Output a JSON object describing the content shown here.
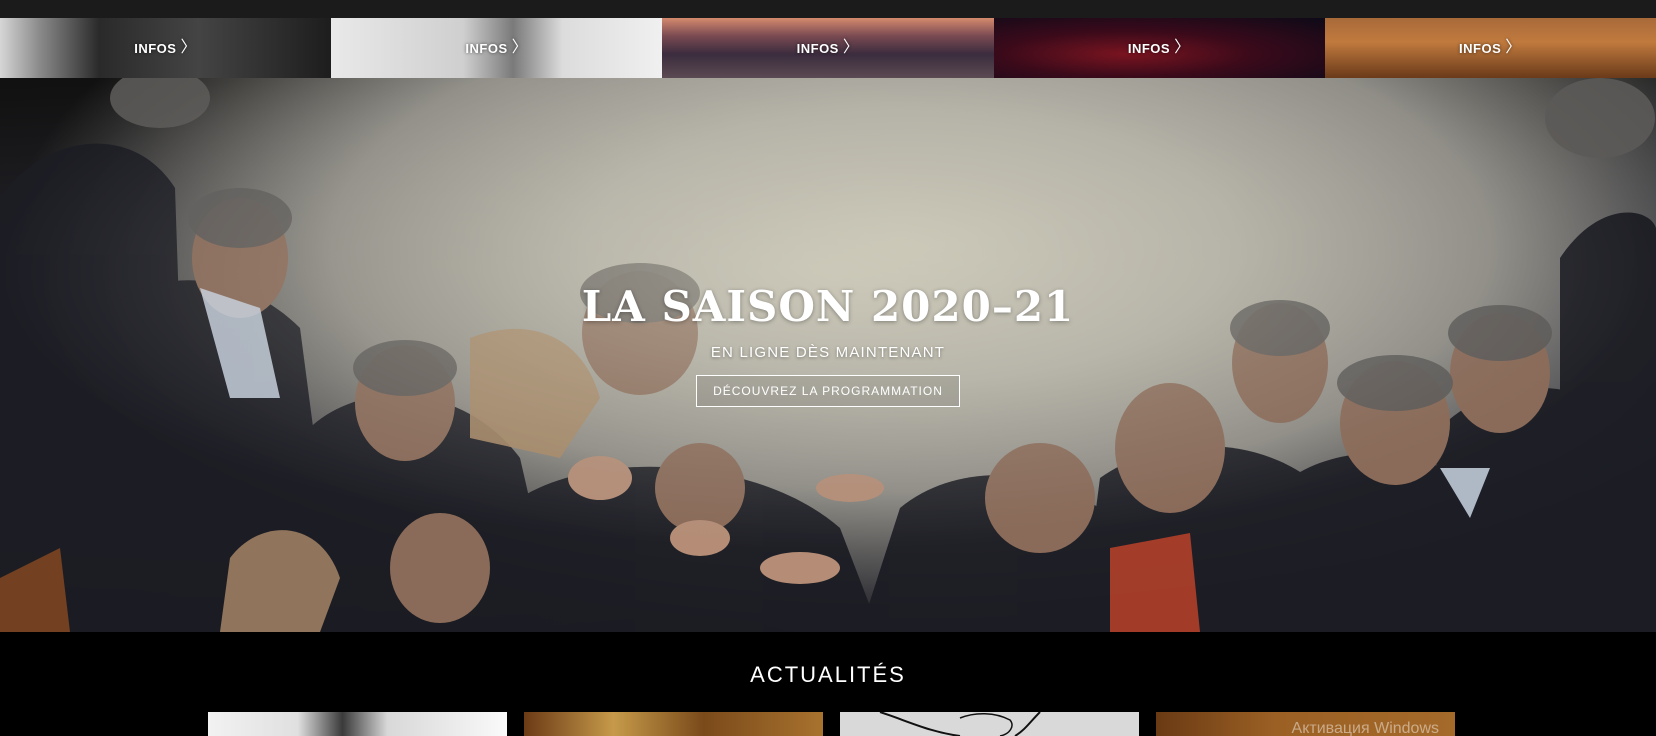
{
  "strip": {
    "items": [
      {
        "label": "INFOS"
      },
      {
        "label": "INFOS"
      },
      {
        "label": "INFOS"
      },
      {
        "label": "INFOS"
      },
      {
        "label": "INFOS"
      }
    ]
  },
  "hero": {
    "title": "LA SAISON 2020–21",
    "subtitle": "EN LIGNE DÈS MAINTENANT",
    "cta_label": "DÉCOUVREZ LA PROGRAMMATION"
  },
  "news": {
    "title": "ACTUALITÉS",
    "watermark": "Активация Windows"
  },
  "icons": {
    "chevron": "chevron-right-icon"
  }
}
